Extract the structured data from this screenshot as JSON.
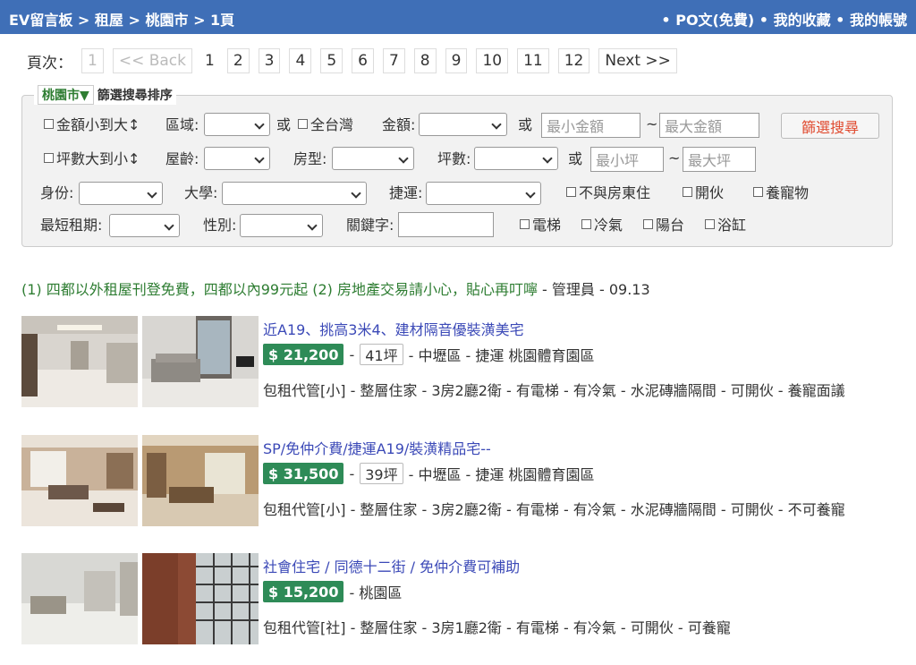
{
  "header": {
    "crumbs": [
      "EV留言板",
      ">",
      "租屋",
      ">",
      "桃園市",
      ">",
      "1頁"
    ],
    "nav": [
      "•",
      "PO文(免費)",
      "•",
      "我的收藏",
      "•",
      "我的帳號"
    ]
  },
  "pager": {
    "label": "頁次：",
    "first": "1",
    "back": "<< Back",
    "current": "1",
    "pages": [
      "2",
      "3",
      "4",
      "5",
      "6",
      "7",
      "8",
      "9",
      "10",
      "11",
      "12"
    ],
    "next": "Next >>"
  },
  "filter": {
    "city": "桃園市▼",
    "title": "篩選搜尋排序",
    "sort_amount": "金額小到大↕",
    "area_label": "區域:",
    "or1": "或",
    "all_taiwan": "全台灣",
    "amount_label": "金額:",
    "or2": "或",
    "min_amount_placeholder": "最小金額",
    "tilde1": "~",
    "max_amount_placeholder": "最大金額",
    "search_button": "篩選搜尋",
    "sort_ping": "坪數大到小↕",
    "age_label": "屋齡:",
    "room_label": "房型:",
    "ping_label": "坪數:",
    "or3": "或",
    "min_ping_placeholder": "最小坪",
    "tilde2": "~",
    "max_ping_placeholder": "最大坪",
    "identity_label": "身份:",
    "university_label": "大學:",
    "mrt_label": "捷運:",
    "no_landlord": "不與房東住",
    "cooking": "開伙",
    "pets": "養寵物",
    "min_rent_label": "最短租期:",
    "gender_label": "性別:",
    "keyword_label": "關鍵字:",
    "elevator": "電梯",
    "aircon": "冷氣",
    "balcony": "陽台",
    "bathtub": "浴缸"
  },
  "notice": {
    "text": "(1) 四都以外租屋刊登免費，四都以內99元起   (2) 房地產交易請小心，貼心再叮嚀",
    "tail": " - 管理員 - 09.13"
  },
  "listings": [
    {
      "title": "近A19、挑高3米4、建材隔音優裝潢美宅",
      "price": "$ 21,200",
      "ping": "41坪",
      "location": "- 中壢區 - 捷運 桃園體育園區",
      "desc": "包租代管[小] - 整層住家 - 3房2廳2衛 - 有電梯 - 有冷氣 - 水泥磚牆隔間 - 可開伙 - 養寵面議"
    },
    {
      "title": "SP/免仲介費/捷運A19/裝潢精品宅--",
      "price": "$ 31,500",
      "ping": "39坪",
      "location": "- 中壢區 - 捷運 桃園體育園區",
      "desc": "包租代管[小] - 整層住家 - 3房2廳2衛 - 有電梯 - 有冷氣 - 水泥磚牆隔間 - 可開伙 - 不可養寵"
    },
    {
      "title": "社會住宅 / 同德十二街 / 免仲介費可補助",
      "price": "$ 15,200",
      "location": "- 桃園區",
      "desc": "包租代管[社] - 整層住家 - 3房1廳2衛 - 有電梯 - 有冷氣 - 可開伙 - 可養寵"
    }
  ]
}
